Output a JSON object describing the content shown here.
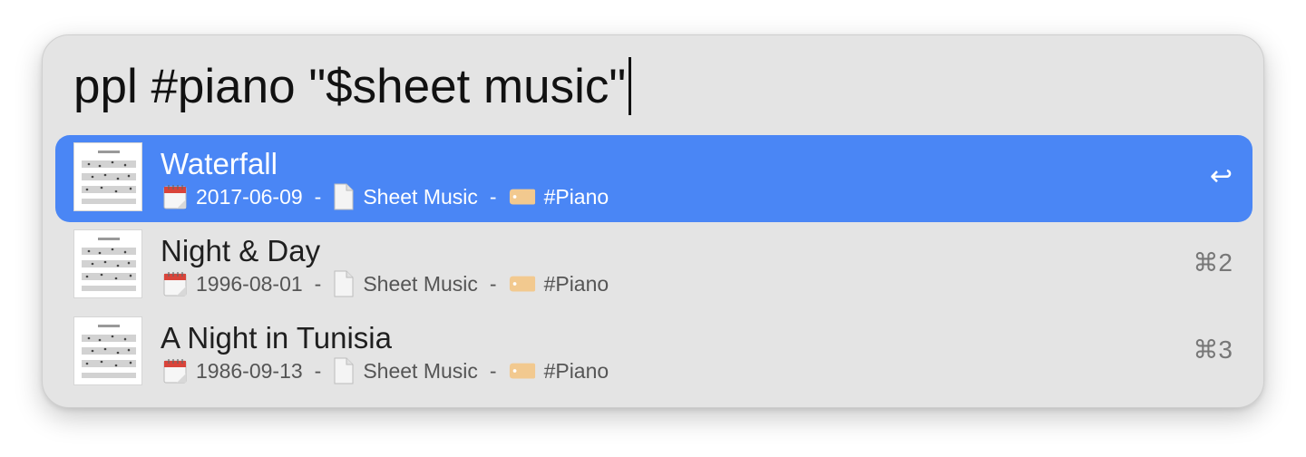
{
  "search": {
    "query": "ppl #piano \"$sheet music\""
  },
  "results": [
    {
      "title": "Waterfall",
      "date": "2017-06-09",
      "kind": "Sheet Music",
      "tag": "#Piano",
      "shortcut": "↩",
      "selected": true,
      "date_icon": "calendar-icon",
      "kind_icon": "document-icon",
      "tag_icon": "tag-icon"
    },
    {
      "title": "Night & Day",
      "date": "1996-08-01",
      "kind": "Sheet Music",
      "tag": "#Piano",
      "shortcut": "⌘2",
      "selected": false,
      "date_icon": "calendar-icon",
      "kind_icon": "document-icon",
      "tag_icon": "tag-icon"
    },
    {
      "title": "A Night in Tunisia",
      "date": "1986-09-13",
      "kind": "Sheet Music",
      "tag": "#Piano",
      "shortcut": "⌘3",
      "selected": false,
      "date_icon": "calendar-icon",
      "kind_icon": "document-icon",
      "tag_icon": "tag-icon"
    }
  ],
  "separator": "-",
  "colors": {
    "selection": "#4a86f5",
    "panel": "#e4e4e4",
    "tag": "#f2c98f",
    "calendar_red": "#d9443a"
  }
}
